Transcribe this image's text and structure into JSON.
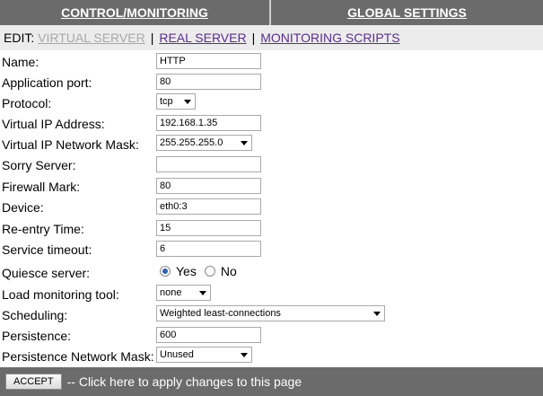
{
  "nav": {
    "control_label": "CONTROL/MONITORING",
    "global_label": "GLOBAL SETTINGS"
  },
  "editbar": {
    "prefix": "EDIT:",
    "current": "VIRTUAL SERVER",
    "sep1": "|",
    "real_server": "REAL SERVER",
    "sep2": "|",
    "monitoring_scripts": "MONITORING SCRIPTS"
  },
  "form": {
    "name": {
      "label": "Name:",
      "value": "HTTP"
    },
    "app_port": {
      "label": "Application port:",
      "value": "80"
    },
    "protocol": {
      "label": "Protocol:",
      "value": "tcp"
    },
    "vip": {
      "label": "Virtual IP Address:",
      "value": "192.168.1.35"
    },
    "vip_mask": {
      "label": "Virtual IP Network Mask:",
      "value": "255.255.255.0"
    },
    "sorry_server": {
      "label": "Sorry Server:",
      "value": ""
    },
    "firewall_mark": {
      "label": "Firewall Mark:",
      "value": "80"
    },
    "device": {
      "label": "Device:",
      "value": "eth0:3"
    },
    "reentry_time": {
      "label": "Re-entry Time:",
      "value": "15"
    },
    "service_timeout": {
      "label": "Service timeout:",
      "value": "6"
    },
    "quiesce": {
      "label": "Quiesce server:",
      "yes": "Yes",
      "no": "No",
      "selected": "yes"
    },
    "load_monitor": {
      "label": "Load monitoring tool:",
      "value": "none"
    },
    "scheduling": {
      "label": "Scheduling:",
      "value": "Weighted least-connections"
    },
    "persistence": {
      "label": "Persistence:",
      "value": "600"
    },
    "persistence_mask": {
      "label": "Persistence Network Mask:",
      "value": "Unused"
    }
  },
  "footer": {
    "accept_label": "ACCEPT",
    "note": "-- Click here to apply changes to this page"
  }
}
